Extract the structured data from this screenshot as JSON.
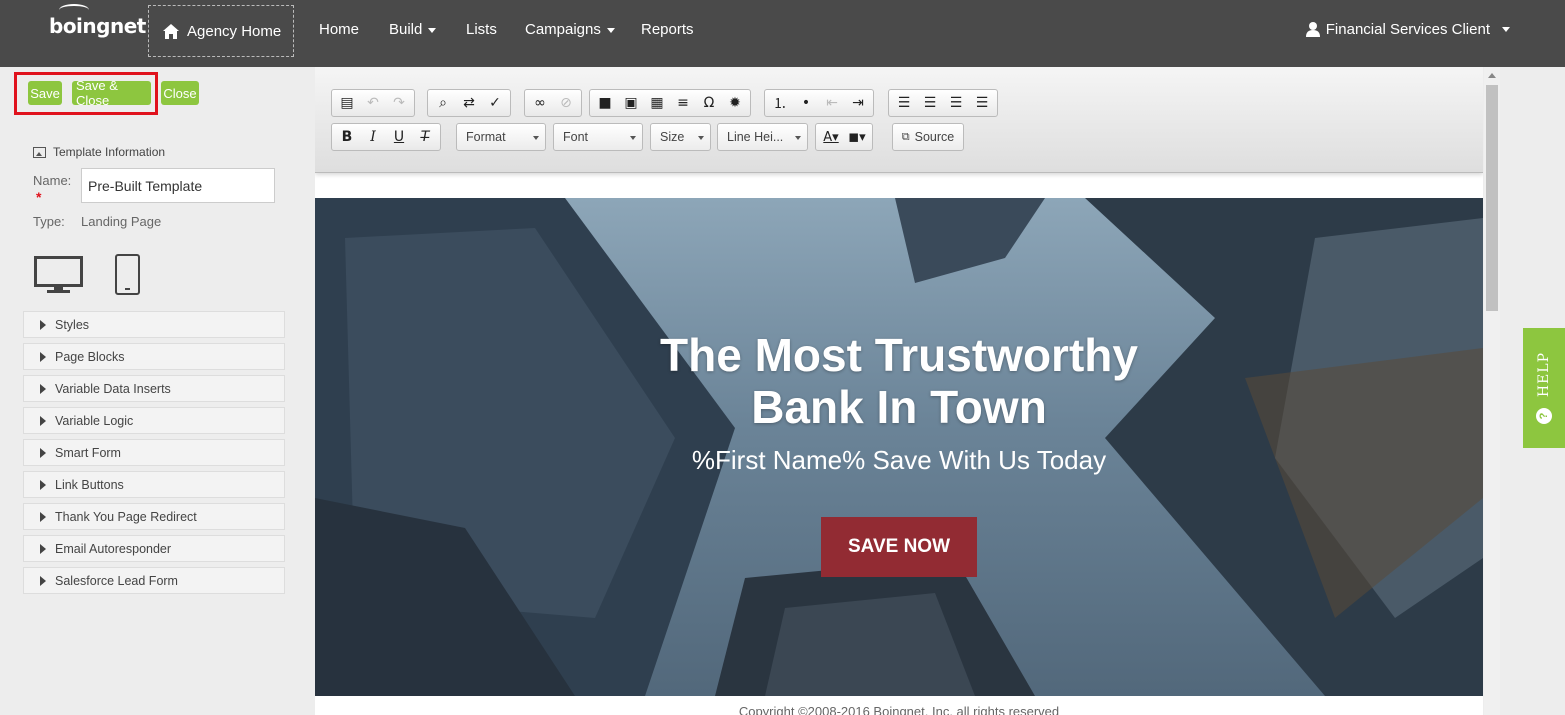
{
  "topnav": {
    "logo": "boingnet",
    "agency_home": "Agency Home",
    "items": [
      "Home",
      "Build",
      "Lists",
      "Campaigns",
      "Reports"
    ],
    "user": "Financial Services Client"
  },
  "actions": {
    "save": "Save",
    "save_close": "Save & Close",
    "close": "Close"
  },
  "template_info": {
    "heading": "Template Information",
    "name_label": "Name:",
    "name_value": "Pre-Built Template",
    "type_label": "Type:",
    "type_value": "Landing Page"
  },
  "accordion": [
    "Styles",
    "Page Blocks",
    "Variable Data Inserts",
    "Variable Logic",
    "Smart Form",
    "Link Buttons",
    "Thank You Page Redirect",
    "Email Autoresponder",
    "Salesforce Lead Form"
  ],
  "toolbar": {
    "format": "Format",
    "font": "Font",
    "size": "Size",
    "line_height": "Line Hei...",
    "source": "Source"
  },
  "hero": {
    "title_line1": "The Most Trustworthy",
    "title_line2": "Bank In Town",
    "subtitle": "%First Name% Save With Us Today",
    "cta": "SAVE NOW"
  },
  "footer": {
    "copyright": "Copyright ©2008-2016 Boingnet, Inc. all rights reserved"
  },
  "help": {
    "label": "HELP"
  },
  "colors": {
    "nav_bg": "#4a4a4a",
    "green": "#8dc63f",
    "highlight": "#e0121d",
    "cta": "#922b33"
  }
}
